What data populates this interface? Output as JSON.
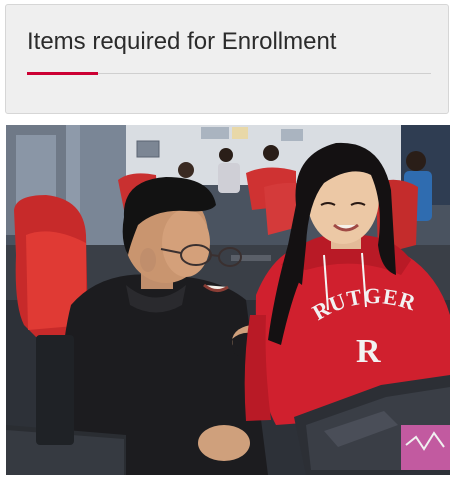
{
  "section": {
    "title": "Items required for Enrollment"
  },
  "photo": {
    "sweatshirt_text": "RUTGERS",
    "sweatshirt_letter": "R"
  },
  "colors": {
    "accent": "#cc0033",
    "card_background": "#efefef",
    "title_text": "#2b2b2b",
    "sweatshirt_red": "#d0202e",
    "hoodie_black": "#1c1c1f",
    "chair_red": "#d23030"
  }
}
